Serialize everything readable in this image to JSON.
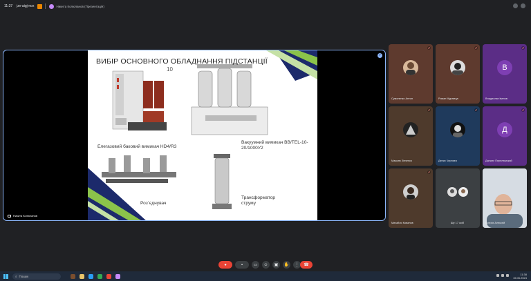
{
  "topbar": {
    "time": "11:37",
    "meeting_code": "jzv-aigj-ncn",
    "tab_title": "Никита Колюланов (Презентація)"
  },
  "presentation": {
    "presenter": "Никита Колюланов",
    "slide_title": "ВИБІР ОСНОВНОГО ОБЛАДНАННЯ ПІДСТАНЦІЇ",
    "slide_subtitle": "10",
    "item1": "Елегазовий баковий вимикач HD4/R3",
    "item2": "Вакуумний вимикач ВВ/TEL-10-20/1000У2",
    "item3": "Роз`єднувач",
    "item4": "Трансформатор струму"
  },
  "participants": [
    {
      "name": "Сумоненко Антон",
      "initial": "",
      "bg": "#5e3a2e"
    },
    {
      "name": "Роман Муравчук",
      "initial": "",
      "bg": "#5e3a2e"
    },
    {
      "name": "Владислав Іванов",
      "initial": "В",
      "bg": "#5b2d86"
    },
    {
      "name": "Максим Зінченко",
      "initial": "",
      "bg": "#4e3a2c"
    },
    {
      "name": "Денис Черняєв",
      "initial": "",
      "bg": "#1f3a5c"
    },
    {
      "name": "Даниил Перелюмский",
      "initial": "Д",
      "bg": "#5b2d86"
    },
    {
      "name": "Михайло Ковалов",
      "initial": "",
      "bg": "#4e3a2c"
    },
    {
      "name": "Ще 17 осіб",
      "initial": "",
      "bg": "#3c4043"
    },
    {
      "name": "Битрих Алексей",
      "initial": "",
      "bg": "#c9cfd6"
    }
  ],
  "taskbar": {
    "search_placeholder": "Пошук",
    "clock_time": "11:38",
    "clock_date": "15.06.2024"
  },
  "colors": {
    "accent": "#8ab4f8",
    "end_call": "#ea4335",
    "slide_navy": "#1c2a6b",
    "slide_green": "#8bc34a"
  }
}
